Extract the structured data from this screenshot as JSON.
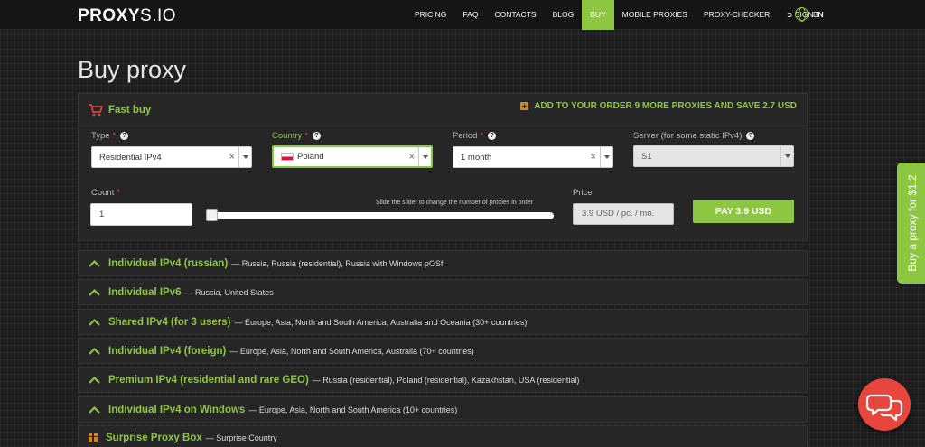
{
  "header": {
    "logo_main": "PROXY",
    "logo_tld": "S.IO",
    "nav": [
      "PRICING",
      "FAQ",
      "CONTACTS",
      "BLOG",
      "BUY",
      "MOBILE PROXIES",
      "PROXY-CHECKER",
      "SIGN IN"
    ],
    "active_nav": "BUY",
    "language": "EN"
  },
  "page_title": "Buy proxy",
  "fast_buy": {
    "title": "Fast buy",
    "promo": "ADD TO YOUR ORDER 9 MORE PROXIES AND SAVE 2.7 USD",
    "type": {
      "label": "Type",
      "value": "Residential IPv4"
    },
    "country": {
      "label": "Country",
      "value": "Poland"
    },
    "period": {
      "label": "Period",
      "value": "1 month"
    },
    "server": {
      "label": "Server (for some static IPv4)",
      "value": "S1"
    },
    "count": {
      "label": "Count",
      "value": "1"
    },
    "slider_hint": "Slide the slider to change the number of proxies in order",
    "price": {
      "label": "Price",
      "value": "3.9 USD / pc. / mo."
    },
    "pay_button": "PAY 3.9 USD"
  },
  "categories": [
    {
      "title": "Individual IPv4 (russian)",
      "desc": "— Russia, Russia (residential), Russia with Windows pOSf"
    },
    {
      "title": "Individual IPv6",
      "desc": "— Russia, United States"
    },
    {
      "title": "Shared IPv4 (for 3 users)",
      "desc": "— Europe, Asia, North and South America, Australia and Oceania (30+ countries)"
    },
    {
      "title": "Individual IPv4 (foreign)",
      "desc": "— Europe, Asia, North and South America, Australia (70+ countries)"
    },
    {
      "title": "Premium IPv4 (residential and rare GEO)",
      "desc": "— Russia (residential), Poland (residential), Kazakhstan, USA (residential)"
    },
    {
      "title": "Individual IPv4 on Windows",
      "desc": "— Europe, Asia, North and South America (10+ countries)"
    },
    {
      "title": "Surprise Proxy Box",
      "desc": "— Surprise Country"
    }
  ],
  "side_tab": "Buy a proxy for $1.2",
  "colors": {
    "accent": "#8dc641",
    "background": "#1e1e1e",
    "panel": "#262626",
    "chat": "#e8463c",
    "cart": "#e04040"
  }
}
